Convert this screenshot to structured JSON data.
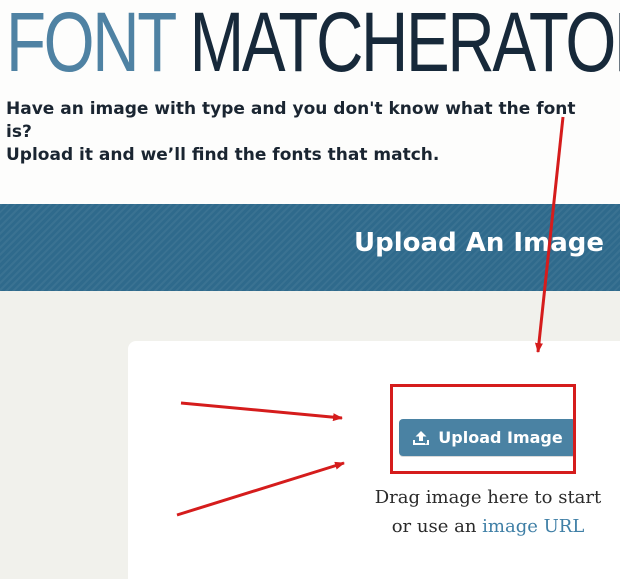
{
  "header": {
    "logo_word1": "FONT",
    "logo_word2": "MATCHERATOR",
    "tagline_line1": "Have an image with type and you don't know what the font is?",
    "tagline_line2": "Upload it and we’ll find the fonts that match."
  },
  "band": {
    "title": "Upload An Image"
  },
  "upload": {
    "button_label": "Upload Image",
    "button_icon": "upload-icon",
    "drag_line1": "Drag image here to start",
    "drag_line2_prefix": "or use an ",
    "image_url_link": "image URL"
  },
  "colors": {
    "logo_word1": "#4f82a3",
    "logo_word2": "#17293a",
    "band": "#2f6a8c",
    "button": "#4a82a3",
    "annotation": "#d51c1c",
    "link": "#3f7fa6"
  }
}
